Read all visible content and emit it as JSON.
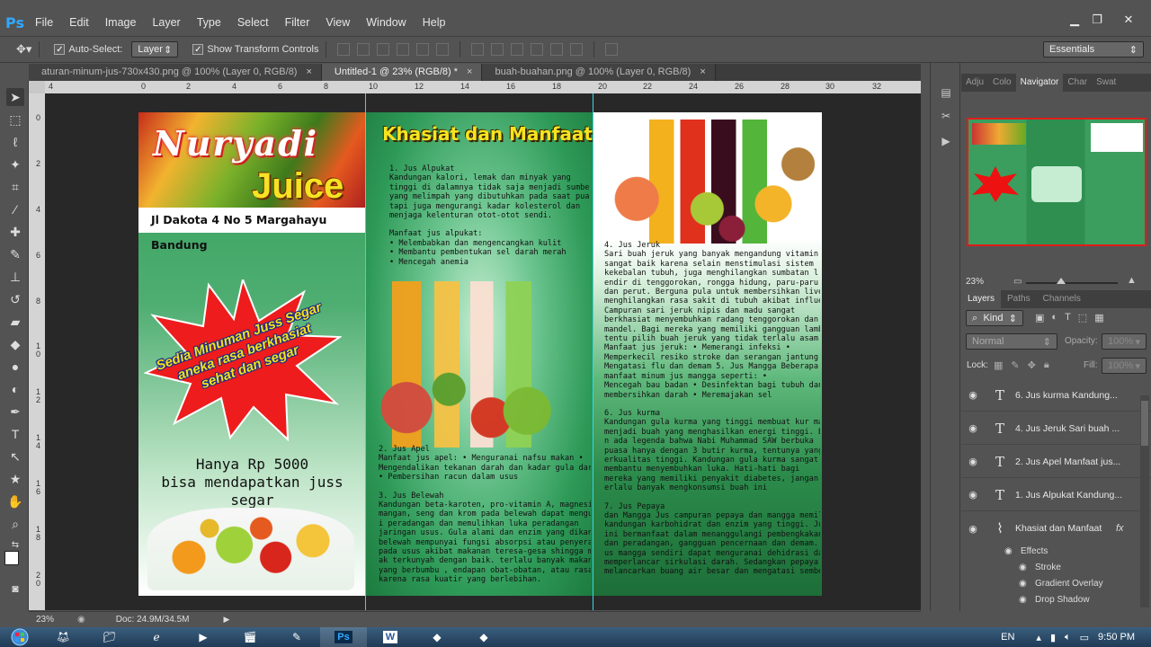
{
  "app": {
    "logo": "Ps",
    "menu": [
      "File",
      "Edit",
      "Image",
      "Layer",
      "Type",
      "Select",
      "Filter",
      "View",
      "Window",
      "Help"
    ],
    "window_controls": {
      "minimize": "▁",
      "restore": "❐",
      "close": "✕"
    }
  },
  "options_bar": {
    "auto_select_label": "Auto-Select:",
    "auto_select_checked": true,
    "auto_select_target": "Layer",
    "show_transform_label": "Show Transform Controls",
    "show_transform_checked": true,
    "workspace": "Essentials"
  },
  "tabs": [
    {
      "label": "aturan-minum-jus-730x430.png @ 100% (Layer 0, RGB/8)",
      "active": false
    },
    {
      "label": "Untitled-1 @ 23% (RGB/8) *",
      "active": true
    },
    {
      "label": "buah-buahan.png @ 100% (Layer 0, RGB/8)",
      "active": false
    }
  ],
  "ruler": {
    "top_ticks": [
      "4",
      "0",
      "2",
      "4",
      "6",
      "8",
      "10",
      "12",
      "14",
      "16",
      "18",
      "20",
      "22",
      "24",
      "26",
      "28",
      "30",
      "32"
    ],
    "left_ticks": [
      "0",
      "2",
      "4",
      "6",
      "8",
      "1\n0",
      "1\n2",
      "1\n4",
      "1\n6",
      "1\n8",
      "2\n0"
    ]
  },
  "document": {
    "panel1": {
      "brand_line1": "Nuryadi",
      "brand_line2": "Juice",
      "address": "Jl Dakota 4 No 5 Margahayu Bandung",
      "starburst_text": [
        "Sedia Minuman Juss Segar",
        "aneka rasa berkhasiat",
        "sehat dan segar"
      ],
      "price_line1": "Hanya Rp 5000",
      "price_line2": "bisa mendapatkan juss segar"
    },
    "panel2": {
      "title": "Khasiat dan Manfaat",
      "block1": [
        "1. Jus Alpukat",
        "Kandungan kalori, lemak dan minyak yang",
        "tinggi di dalamnya tidak saja menjadi sumber enerji",
        "yang melimpah yang dibutuhkan pada saat puasa,",
        " tapi juga mengurangi kadar kolesterol dan",
        "menjaga kelenturan otot-otot sendi.",
        "",
        "Manfaat jus alpukat:",
        "• Melembabkan dan mengencangkan kulit",
        "• Membantu pembentukan sel darah merah",
        "• Mencegah anemia"
      ],
      "block2": [
        "2. Jus Apel",
        " Manfaat jus apel: •  Menguranai nafsu makan •",
        "Mengendalikan tekanan darah dan kadar gula darah",
        "  • Pembersihan racun dalam usus",
        "",
        "3. Jus Belewah",
        "Kandungan beta-karoten, pro-vitamin A,  magnesium,",
        "mangan, seng dan krom pada belewah  dapat mengurang",
        "i peradangan dan memulihkan luka  peradangan",
        "jaringan usus.  Gula alami dan enzim yang dikandung",
        "belewah mempunyai fungsi absorpsi  atau penyerapan",
        "pada usus akibat makanan teresa-gesa  shingga makanan t",
        "ak terkunyah dengan baik.  terlalu banyak makan makanan",
        " yang berbumbu , endapan obat-obatan, atau rasa mual",
        "karena  rasa kuatir yang berlebihan."
      ]
    },
    "panel3": {
      "block1": [
        "4. Jus Jeruk",
        "Sari buah jeruk yang banyak mengandung vitamin  C",
        "sangat baik karena selain menstimulasi  sistem",
        "kekebalan tubuh, juga menghilangkan sumbatan l",
        "endir di tenggorokan,  rongga hidung, paru-paru",
        "dan perut. Berguna pula untuk membersihkan liver dan",
        "  menghilangkan rasa sakit di tubuh akibat influenza.",
        "Campuran sari jeruk nipis dan madu sangat",
        "berkhasiat menyembuhkan radang  tenggorokan dan a",
        "mandel. Bagi mereka yang  memiliki gangguan lambung,",
        " tentu pilih  buah jeruk yang tidak terlalu asam.",
        "  Manfaat jus jeruk: • Memerangi infeksi •",
        "Memperkecil resiko stroke dan serangan jantung •",
        "  Mengatasi flu dan demam  5. Jus Mangga Beberapa",
        "manfaat minum jus mangga seperti: •",
        "Mencegah bau badan • Desinfektan bagi tubuh dan",
        "membersihkan darah • Meremajakan sel",
        "",
        "6. Jus kurma",
        "Kandungan gula kurma yang tinggi membuat kur ma",
        "menjadi buah yang menghasilkan energi tinggi. Bahka",
        "n ada legenda bahwa Nabi Muhammad SAW berbuka",
        "puasa hanya dengan 3 butir kurma,  tentunya yang b",
        "erkualitas tinggi.  Kandungan gula kurma sangat",
        "membantu  menyembuhkan luka. Hati-hati bagi",
        " mereka yang memiliki penyakit diabetes,  jangan t",
        "erlalu banyak mengkonsumsi buah ini",
        "",
        "7. Jus Pepaya",
        " dan Mangga Jus campuran pepaya dan mangga memiliki",
        " kandungan karbohidrat dan enzim yang tinggi. Jus segar",
        "  ini bermanfaat dalam menanggulangi  pembengkakan",
        " dan peradangan, gangguan  pencernaan dan demam. J",
        "us mangga sendiri dapat  menguranai dehidrasi dan",
        "memperlancar  sirkulasi darah.  Sedangkan pepaya",
        " melancarkan  buang air besar dan mengatasi sembelit."
      ]
    }
  },
  "right_panel": {
    "top_tabs": [
      {
        "label": "Adju",
        "active": false
      },
      {
        "label": "Colo",
        "active": false
      },
      {
        "label": "Navigator",
        "active": true
      },
      {
        "label": "Char",
        "active": false
      },
      {
        "label": "Swat",
        "active": false
      }
    ],
    "navigator_zoom": "23%",
    "layer_tabs": [
      {
        "label": "Layers",
        "active": true
      },
      {
        "label": "Paths",
        "active": false
      },
      {
        "label": "Channels",
        "active": false
      }
    ],
    "filter_kind": "Kind",
    "blend_mode": "Normal",
    "opacity_label": "Opacity:",
    "opacity_value": "100%",
    "lock_label": "Lock:",
    "fill_label": "Fill:",
    "fill_value": "100%",
    "layers": [
      {
        "name": "6. Jus kurma  Kandung...",
        "type": "T"
      },
      {
        "name": "4. Jus Jeruk  Sari buah ...",
        "type": "T"
      },
      {
        "name": "2. Jus Apel  Manfaat jus...",
        "type": "T"
      },
      {
        "name": "1. Jus Alpukat Kandung...",
        "type": "T"
      },
      {
        "name": "Khasiat dan Manfaat",
        "type": "warp",
        "fx": "fx"
      }
    ],
    "effects": [
      "Effects",
      "Stroke",
      "Gradient Overlay",
      "Drop Shadow"
    ]
  },
  "status": {
    "zoom": "23%",
    "doc": "Doc: 24.9M/34.5M"
  },
  "taskbar": {
    "lang": "EN",
    "time": "9:50 PM"
  },
  "colors": {
    "ui_bg": "#535353",
    "canvas_bg": "#282828",
    "guide": "#38d7e6",
    "accent_green": "#2e9a58",
    "title_yellow": "#f7e41f"
  }
}
